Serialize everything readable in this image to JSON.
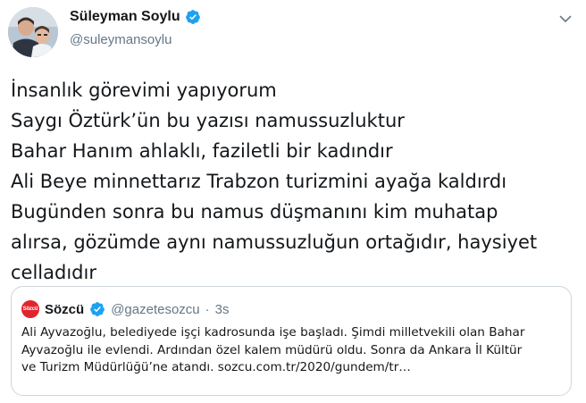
{
  "author": {
    "display_name": "Süleyman Soylu",
    "handle": "@suleymansoylu",
    "avatar_icon": "profile-photo",
    "verified_icon": "verified-badge-icon"
  },
  "tweet": {
    "lines": [
      "İnsanlık görevimi yapıyorum",
      "Saygı Öztürk’ün bu yazısı namussuzluktur",
      "Bahar Hanım ahlaklı, faziletli bir kadındır",
      "Ali Beye minnettarız Trabzon turizmini ayağa kaldırdı",
      "Bugünden sonra bu namus düşmanını kim muhatap",
      "alırsa, gözümde aynı namussuzluğun ortağıdır, haysiyet",
      "celladıdır"
    ]
  },
  "quoted": {
    "avatar_text": "Sözcü",
    "name": "Sözcü",
    "handle": "@gazetesozcu",
    "separator": "·",
    "time": "3s",
    "lines": [
      "Ali Ayvazoğlu, belediyede işçi kadrosunda işe başladı. Şimdi milletvekili olan Bahar",
      "Ayvazoğlu ile evlendi. Ardından özel kalem müdürü oldu. Sonra da Ankara İl Kültür",
      "ve Turizm Müdürlüğü’ne atandı. sozcu.com.tr/2020/gundem/tr…"
    ]
  },
  "colors": {
    "verified": "#1da1f2",
    "text_primary": "#14171a",
    "text_secondary": "#657786",
    "border": "#ccd6dd",
    "sozcu_red": "#e0242b"
  }
}
